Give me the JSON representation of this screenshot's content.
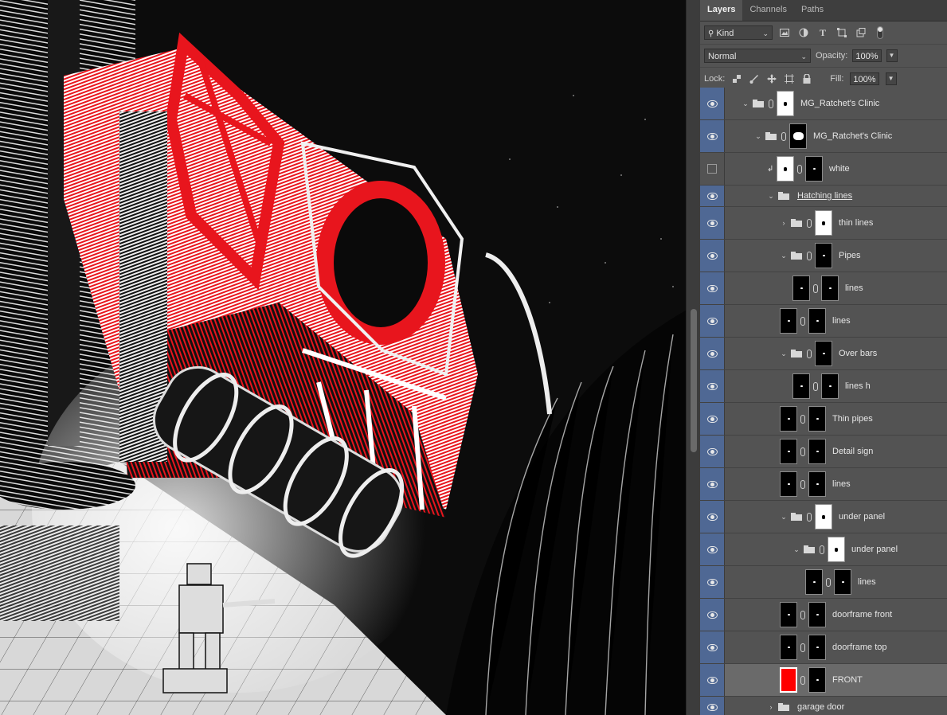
{
  "panel": {
    "tabs": [
      "Layers",
      "Channels",
      "Paths"
    ],
    "active_tab": "Layers",
    "filter": {
      "kind_label": "Kind",
      "icons": [
        "image-filter-icon",
        "adjustment-filter-icon",
        "type-filter-icon",
        "shape-filter-icon",
        "smart-object-filter-icon",
        "filter-toggle-icon"
      ]
    },
    "blend_mode": "Normal",
    "opacity_label": "Opacity:",
    "opacity_value": "100%",
    "lock_label": "Lock:",
    "lock_icons": [
      "lock-transparent-icon",
      "lock-paint-icon",
      "lock-position-icon",
      "lock-artboard-icon",
      "lock-all-icon"
    ],
    "fill_label": "Fill:",
    "fill_value": "100%"
  },
  "layers": [
    {
      "name": "MG_Ratchet's Clinic",
      "type": "group",
      "expanded": true,
      "indent": 0,
      "visible": true,
      "mask": "white"
    },
    {
      "name": "MG_Ratchet's Clinic",
      "type": "group",
      "expanded": true,
      "indent": 1,
      "visible": true,
      "mask": "black-white-blob"
    },
    {
      "name": "white",
      "type": "layer",
      "indent": 2,
      "visible": false,
      "clipped": true,
      "thumb": "white",
      "mask": "black"
    },
    {
      "name": "Hatching lines",
      "type": "group",
      "expanded": true,
      "indent": 2,
      "visible": true,
      "underline": true
    },
    {
      "name": "thin lines",
      "type": "group",
      "expanded": false,
      "indent": 3,
      "visible": true,
      "mask": "white"
    },
    {
      "name": "Pipes",
      "type": "group",
      "expanded": true,
      "indent": 3,
      "visible": true,
      "mask": "black"
    },
    {
      "name": "lines",
      "type": "layer",
      "indent": 4,
      "visible": true,
      "thumb": "black",
      "mask": "black"
    },
    {
      "name": "lines",
      "type": "layer",
      "indent": 3,
      "visible": true,
      "thumb": "black",
      "mask": "black"
    },
    {
      "name": "Over bars",
      "type": "group",
      "expanded": true,
      "indent": 3,
      "visible": true,
      "mask": "black"
    },
    {
      "name": "lines h",
      "type": "layer",
      "indent": 4,
      "visible": true,
      "thumb": "black",
      "mask": "black"
    },
    {
      "name": "Thin pipes",
      "type": "layer",
      "indent": 3,
      "visible": true,
      "thumb": "black",
      "mask": "black"
    },
    {
      "name": "Detail sign",
      "type": "layer",
      "indent": 3,
      "visible": true,
      "thumb": "black",
      "mask": "black"
    },
    {
      "name": "lines",
      "type": "layer",
      "indent": 3,
      "visible": true,
      "thumb": "black",
      "mask": "black"
    },
    {
      "name": "under panel",
      "type": "group",
      "expanded": true,
      "indent": 3,
      "visible": true,
      "mask": "white"
    },
    {
      "name": "under panel",
      "type": "group",
      "expanded": true,
      "indent": 4,
      "visible": true,
      "mask": "white"
    },
    {
      "name": "lines",
      "type": "layer",
      "indent": 5,
      "visible": true,
      "thumb": "black",
      "mask": "black"
    },
    {
      "name": "doorframe front",
      "type": "layer",
      "indent": 3,
      "visible": true,
      "thumb": "black",
      "mask": "black"
    },
    {
      "name": "doorframe top",
      "type": "layer",
      "indent": 3,
      "visible": true,
      "thumb": "black",
      "mask": "black"
    },
    {
      "name": "FRONT",
      "type": "layer",
      "indent": 3,
      "visible": true,
      "thumb": "red",
      "mask": "black",
      "selected": true
    },
    {
      "name": "garage door",
      "type": "group",
      "expanded": false,
      "indent": 2,
      "visible": true
    }
  ],
  "colors": {
    "panel_bg": "#535353",
    "eye_column": "#4f6894",
    "selected_row": "#6a6a6a",
    "accent_red": "#ff0000",
    "canvas_black": "#0c0c0c"
  }
}
